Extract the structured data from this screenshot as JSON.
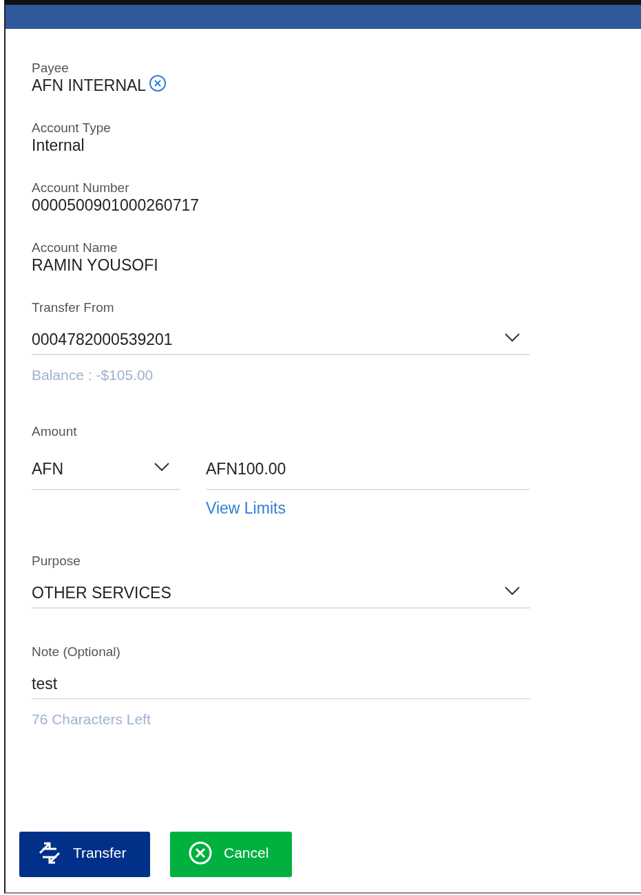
{
  "details": [
    {
      "label": "Payee",
      "value": "AFN INTERNAL",
      "clearable": true
    },
    {
      "label": "Account Type",
      "value": "Internal",
      "clearable": false
    },
    {
      "label": "Account Number",
      "value": "0000500901000260717",
      "clearable": false
    },
    {
      "label": "Account Name",
      "value": "RAMIN YOUSOFI",
      "clearable": false
    }
  ],
  "transfer_from": {
    "label": "Transfer From",
    "value": "0004782000539201",
    "balance": "Balance : -$105.00"
  },
  "amount": {
    "label": "Amount",
    "currency": "AFN",
    "value": "AFN100.00",
    "link": "View Limits"
  },
  "purpose": {
    "label": "Purpose",
    "value": "OTHER SERVICES"
  },
  "note": {
    "label": "Note (Optional)",
    "value": "test",
    "counter": "76 Characters Left"
  },
  "buttons": [
    {
      "label": "Transfer",
      "kind": "primary"
    },
    {
      "label": "Cancel",
      "kind": "cancel"
    }
  ]
}
